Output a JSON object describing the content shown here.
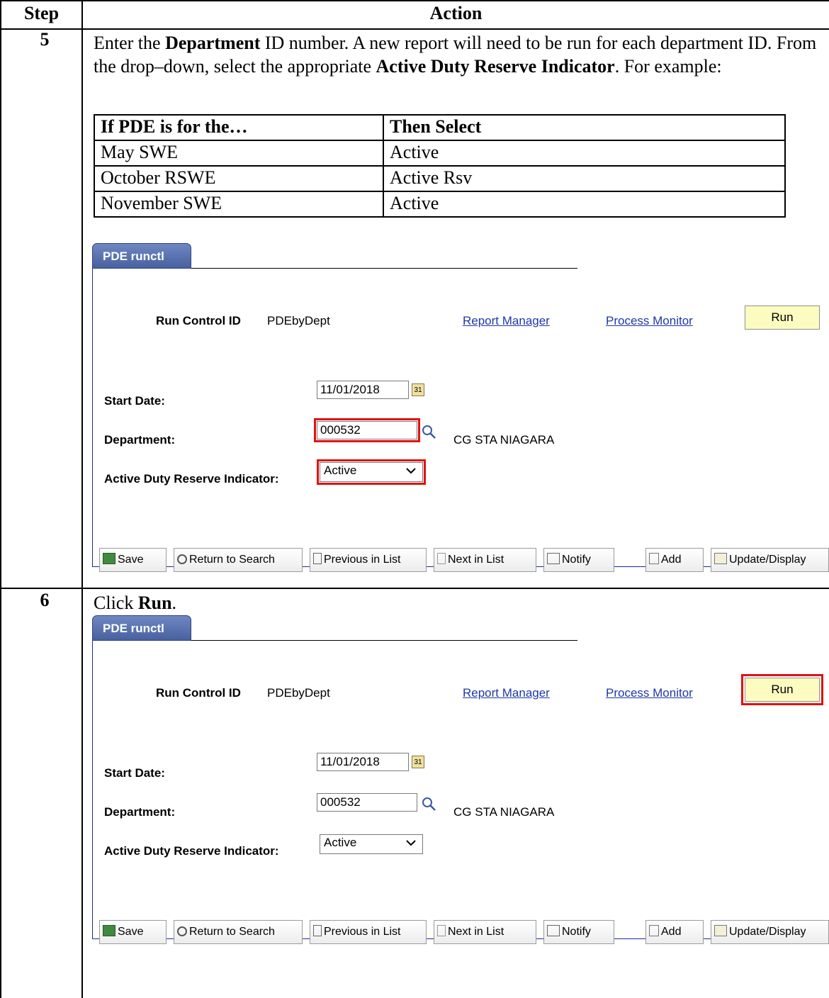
{
  "table": {
    "col_step": "Step",
    "col_action": "Action"
  },
  "steps": [
    {
      "number": "5",
      "text_parts": [
        {
          "t": "Enter the ",
          "b": false
        },
        {
          "t": "Department",
          "b": true
        },
        {
          "t": " ID number.  A new report will need to be run for each department ID.  From the drop–down, select the appropriate ",
          "b": false
        },
        {
          "t": "Active Duty Reserve Indicator",
          "b": true
        },
        {
          "t": ".  For example:",
          "b": false
        }
      ],
      "example_table": {
        "headers": [
          "If PDE is for the…",
          "Then Select"
        ],
        "rows": [
          [
            "May SWE",
            "Active"
          ],
          [
            "October RSWE",
            "Active Rsv"
          ],
          [
            "November SWE",
            "Active"
          ]
        ]
      }
    },
    {
      "number": "6",
      "text_parts": [
        {
          "t": "Click ",
          "b": false
        },
        {
          "t": "Run",
          "b": true
        },
        {
          "t": ".",
          "b": false
        }
      ]
    }
  ],
  "panel": {
    "tab_label": "PDE runctl",
    "run_control_label": "Run Control ID",
    "run_control_value": "PDEbyDept",
    "report_manager": "Report Manager",
    "process_monitor": "Process Monitor",
    "run_button": "Run",
    "start_date_label": "Start Date:",
    "start_date_value": "11/01/2018",
    "department_label": "Department:",
    "department_value": "000532",
    "department_desc": "CG STA NIAGARA",
    "indicator_label": "Active Duty Reserve Indicator:",
    "indicator_value": "Active",
    "toolbar": {
      "save": "Save",
      "return_to_search": "Return to Search",
      "previous_in_list": "Previous in List",
      "next_in_list": "Next in List",
      "notify": "Notify",
      "add": "Add",
      "update_display": "Update/Display"
    },
    "highlight_color": "#e01212",
    "link_color": "#1f38a8",
    "tab_color": "#5670b0",
    "run_button_color": "#fdfcc0"
  }
}
